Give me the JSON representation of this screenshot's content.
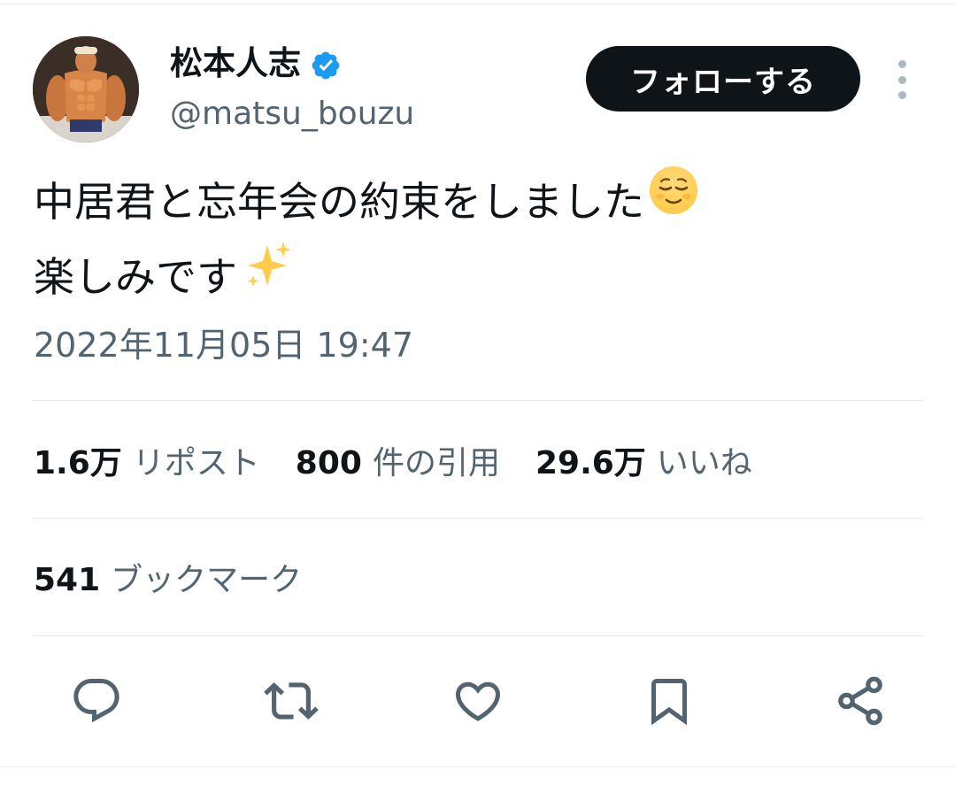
{
  "author": {
    "display_name": "松本人志",
    "handle": "@matsu_bouzu",
    "verified": true,
    "avatar": "muscular-figure-avatar"
  },
  "follow_button_label": "フォローする",
  "tweet": {
    "line1": "中居君と忘年会の約束をしました",
    "line1_emoji": "relieved-face-emoji",
    "line2": "楽しみです",
    "line2_emoji": "sparkles-emoji"
  },
  "timestamp": "2022年11月05日 19:47",
  "stats": {
    "reposts_count": "1.6万",
    "reposts_label": "リポスト",
    "quotes_count": "800",
    "quotes_label": "件の引用",
    "likes_count": "29.6万",
    "likes_label": "いいね",
    "bookmarks_count": "541",
    "bookmarks_label": "ブックマーク"
  },
  "actions": [
    "reply-icon",
    "repost-icon",
    "like-icon",
    "bookmark-icon",
    "share-icon"
  ],
  "colors": {
    "text": "#0f1419",
    "secondary": "#536471",
    "verified": "#1d9bf0",
    "button_bg": "#0f1419"
  }
}
